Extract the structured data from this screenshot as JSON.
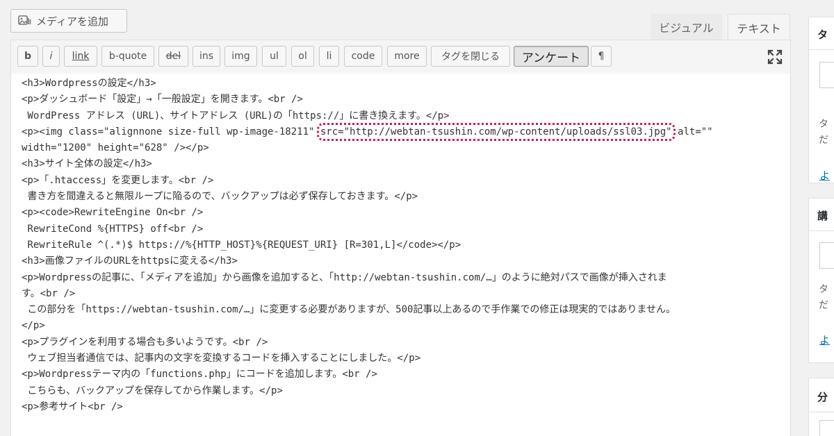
{
  "media_button_label": "メディアを追加",
  "tabs": {
    "visual": "ビジュアル",
    "text": "テキスト"
  },
  "toolbar": {
    "buttons": [
      "b",
      "i",
      "link",
      "b-quote",
      "del",
      "ins",
      "img",
      "ul",
      "ol",
      "li",
      "code",
      "more",
      "タグを閉じる",
      "アンケート",
      "¶"
    ]
  },
  "editor": {
    "lines": [
      "<h3>Wordpressの設定</h3>",
      "<p>ダッシュボード「設定」→「一般設定」を開きます。<br />",
      " WordPress アドレス (URL)、サイトアドレス (URL)の「https://」に書き換えます。</p>",
      "<p><img class=\"alignnone size-full wp-image-18211\" ",
      "width=\"1200\" height=\"628\" /></p>",
      "<h3>サイト全体の設定</h3>",
      "<p>「.htaccess」を変更します。<br />",
      " 書き方を間違えると無限ループに陥るので、バックアップは必ず保存しておきます。</p>",
      "<p><code>RewriteEngine On<br />",
      " RewriteCond %{HTTPS} off<br />",
      " RewriteRule ^(.*)$ https://%{HTTP_HOST}%{REQUEST_URI} [R=301,L]</code></p>",
      "<h3>画像ファイルのURLをhttpsに変える</h3>",
      "<p>Wordpressの記事に、「メディアを追加」から画像を追加すると、「http://webtan-tsushin.com/…」のように絶対パスで画像が挿入されま",
      "す。<br />",
      " この部分を「https://webtan-tsushin.com/…」に変更する必要がありますが、500記事以上あるので手作業での修正は現実的ではありません。",
      "</p>",
      "<p>プラグインを利用する場合も多いようです。<br />",
      " ウェブ担当者通信では、記事内の文字を変換するコードを挿入することにしました。</p>",
      "<p>Wordpressテーマ内の「functions.php」にコードを追加します。<br />",
      " こちらも、バックアップを保存してから作業します。</p>",
      "<p>参考サイト<br />"
    ],
    "highlight": "src=\"http://webtan-tsushin.com/wp-content/uploads/ssl03.jpg\"",
    "after_highlight": " alt=\"\""
  },
  "sidebar": {
    "card1": {
      "heading": "タ",
      "text1": "タ",
      "text2": "だ",
      "link": "よ"
    },
    "card2": {
      "heading": "講",
      "text1": "タ",
      "text2": "だ",
      "link": "よ"
    },
    "card3": {
      "heading": "分"
    }
  },
  "colors": {
    "highlight": "#d8145a",
    "link": "#0073aa"
  }
}
